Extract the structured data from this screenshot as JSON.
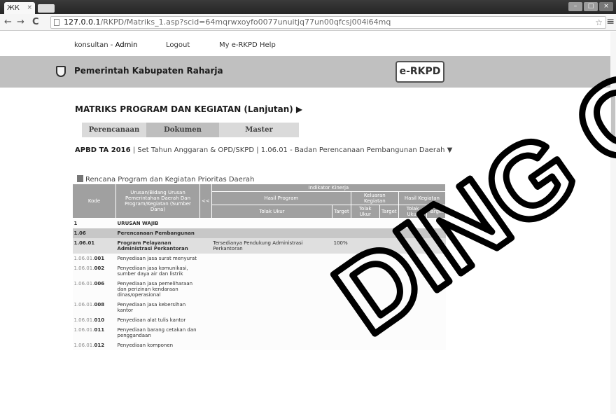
{
  "browser": {
    "tab_title": "ЖК",
    "tab_close": "×",
    "nav_back": "←",
    "nav_forward": "→",
    "nav_reload": "C",
    "url_host": "127.0.0.1",
    "url_path": "/RKPD/Matriks_1.asp?scid=64mqrwxoyfo0077unuitjq77un00qfcsj004i64mq",
    "star": "☆",
    "menu": "≡"
  },
  "topnav": {
    "user_prefix": "konsultan - ",
    "user_name": "Admin",
    "logout": "Logout",
    "my_erkpd": "My e-RKPD",
    "help": "Help"
  },
  "header": {
    "org": "Pemerintah Kabupaten Raharja",
    "brand": "e-RKPD"
  },
  "page": {
    "title": "MATRIKS PROGRAM DAN KEGIATAN (Lanjutan) ▶",
    "tabs": [
      "Perencanaan",
      "Dokumen",
      "Master"
    ],
    "apbd": "APBD TA 2016",
    "subheader_rest": " | Set Tahun Anggaran & OPD/SKPD | 1.06.01 - Badan Perencanaan Pembangunan Daerah ▼",
    "section_label": "Rencana Program dan Kegiatan Prioritas Daerah"
  },
  "table": {
    "h_kode": "Kode",
    "h_urusan": "Urusan/Bidang Urusan Pemerintahan Daerah Dan Program/Kegiatan (Sumber Dana)",
    "h_toggle": "<<",
    "h_indikator": "Indikator Kinerja",
    "h_hasil_program": "Hasil Program",
    "h_keluaran": "Keluaran Kegiatan",
    "h_hasil_kegiatan": "Hasil Kegiatan",
    "h_tolak": "Tolak Ukur",
    "h_target": "Target",
    "rows": [
      {
        "kode": "1",
        "kode_bold": "",
        "name": "URUSAN WAJIB",
        "tolak": "",
        "target": "",
        "style": "r-white",
        "bold": true
      },
      {
        "kode": "1.06",
        "kode_bold": "",
        "name": "Perencanaan Pembangunan",
        "tolak": "",
        "target": "",
        "style": "r-grey",
        "bold": true
      },
      {
        "kode": "1.06.",
        "kode_bold": "01",
        "name": "Program Pelayanan Administrasi Perkantoran",
        "tolak": "Tersedianya Pendukung Administrasi Perkantoran",
        "target": "100%",
        "style": "r-light",
        "bold": true
      },
      {
        "kode": "1.06.01.",
        "kode_bold": "001",
        "name": "Penyediaan jasa surat menyurat",
        "tolak": "",
        "target": "",
        "style": "r-white",
        "bold": false
      },
      {
        "kode": "1.06.01.",
        "kode_bold": "002",
        "name": "Penyediaan jasa komunikasi, sumber daya air dan listrik",
        "tolak": "",
        "target": "",
        "style": "r-white",
        "bold": false
      },
      {
        "kode": "1.06.01.",
        "kode_bold": "006",
        "name": "Penyediaan jasa pemeliharaan dan perizinan kendaraan dinas/operasional",
        "tolak": "",
        "target": "",
        "style": "r-white",
        "bold": false
      },
      {
        "kode": "1.06.01.",
        "kode_bold": "008",
        "name": "Penyediaan jasa kebersihan kantor",
        "tolak": "",
        "target": "",
        "style": "r-white",
        "bold": false
      },
      {
        "kode": "1.06.01.",
        "kode_bold": "010",
        "name": "Penyediaan alat tulis kantor",
        "tolak": "",
        "target": "",
        "style": "r-white",
        "bold": false
      },
      {
        "kode": "1.06.01.",
        "kode_bold": "011",
        "name": "Penyediaan barang cetakan dan penggandaan",
        "tolak": "",
        "target": "",
        "style": "r-white",
        "bold": false
      },
      {
        "kode": "1.06.01.",
        "kode_bold": "012",
        "name": "Penyediaan komponen",
        "tolak": "",
        "target": "",
        "style": "r-white",
        "bold": false
      }
    ]
  },
  "watermark": {
    "text": "DING CO",
    "color": "#000000"
  }
}
